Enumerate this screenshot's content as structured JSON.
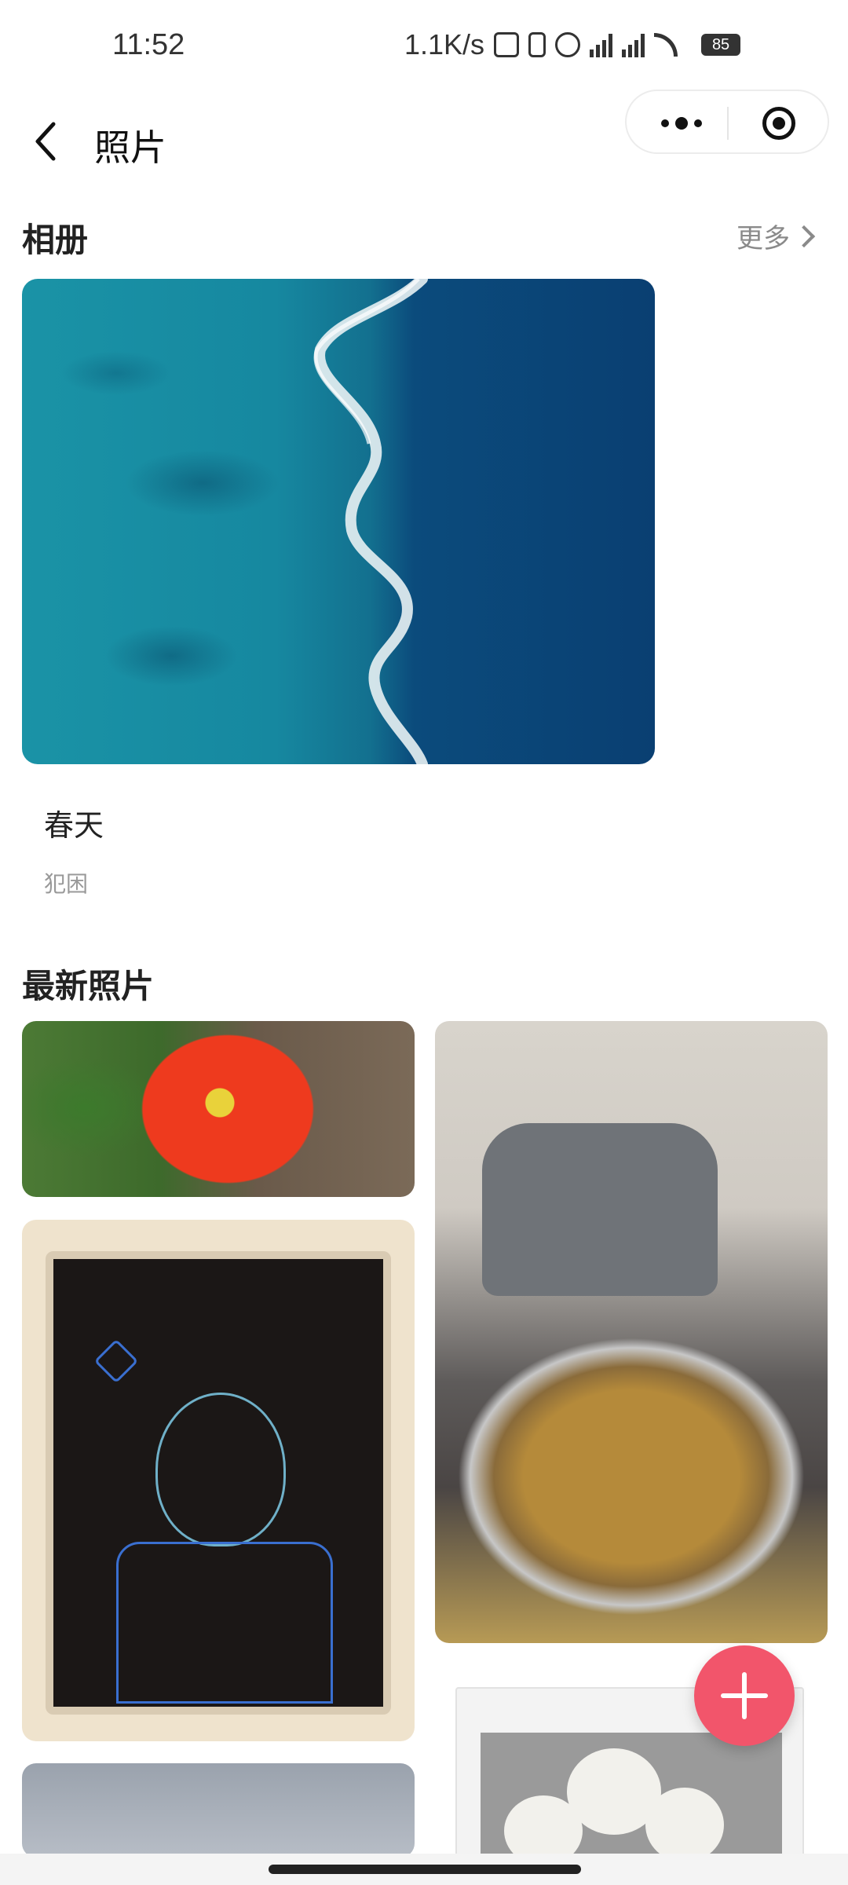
{
  "status_bar": {
    "time": "11:52",
    "net_speed": "1.1K/s",
    "battery": "85",
    "icons": [
      "nfc-icon",
      "vibrate-icon",
      "alarm-icon",
      "signal-icon",
      "signal-icon",
      "wifi-icon",
      "battery-icon"
    ]
  },
  "nav": {
    "title": "照片",
    "back_icon": "chevron-left-icon",
    "capsule_icons": [
      "more-dots-icon",
      "target-icon"
    ]
  },
  "album_section": {
    "title": "相册",
    "more_label": "更多",
    "more_icon": "chevron-right-icon",
    "albums": [
      {
        "name": "春天",
        "subtitle": "犯困"
      }
    ]
  },
  "latest_section": {
    "title": "最新照片"
  },
  "fab": {
    "icon": "plus-icon",
    "color": "#f2556b"
  }
}
